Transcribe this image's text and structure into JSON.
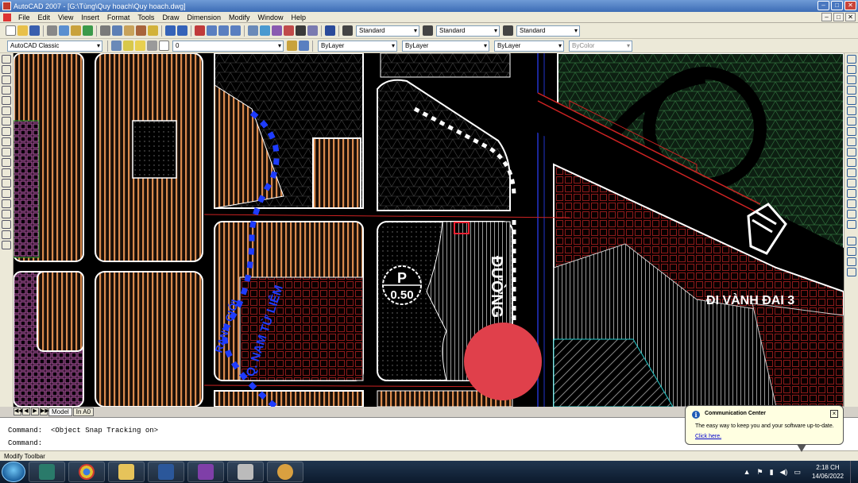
{
  "window": {
    "title": "AutoCAD 2007 - [G:\\Tùng\\Quy hoạch\\Quy hoach.dwg]",
    "controls": [
      "–",
      "□",
      "✕"
    ]
  },
  "menu": {
    "items": [
      "File",
      "Edit",
      "View",
      "Insert",
      "Format",
      "Tools",
      "Draw",
      "Dimension",
      "Modify",
      "Window",
      "Help"
    ]
  },
  "toolbar": {
    "text_style": "Standard",
    "dim_style": "Standard",
    "table_style": "Standard",
    "workspace": "AutoCAD Classic",
    "layer": "0",
    "color": "ByLayer",
    "linetype": "ByLayer",
    "lineweight": "ByLayer",
    "plot_style": "ByColor"
  },
  "drawing": {
    "road_label": "ĐI VÀNH ĐAI 3",
    "street_label": "ĐƯỜNG",
    "parking_letter": "P",
    "parking_value": "0.50",
    "blue_label_1": "Q. NAM TỪ LIÊM",
    "blue_label_2": "RANH GIỚI",
    "colors": {
      "background": "#000000",
      "hatch_orange": "#d98a4e",
      "hatch_red_grid": "#8b1a1a",
      "hatch_magenta": "#c060b0",
      "green_area": "#2e6b3a",
      "boundary_blue": "#1e3cff",
      "road_red": "#cc2222",
      "marker_red": "#e0404b"
    }
  },
  "layout_tabs": {
    "nav": [
      "◀◀",
      "◀",
      "▶",
      "▶▶"
    ],
    "tabs": [
      "Model",
      "In A0"
    ]
  },
  "command": {
    "line1": "Command:  <Object Snap Tracking on>",
    "line2": "Command:"
  },
  "status": {
    "text": "Modify Toolbar"
  },
  "notification": {
    "title": "Communication Center",
    "message": "The easy way to keep you and your software up-to-date.",
    "link": "Click here."
  },
  "taskbar": {
    "apps": [
      "autocad",
      "chrome",
      "explorer",
      "word",
      "onenote",
      "printer",
      "paint"
    ],
    "clock_time": "2:18 CH",
    "clock_date": "14/06/2022"
  }
}
